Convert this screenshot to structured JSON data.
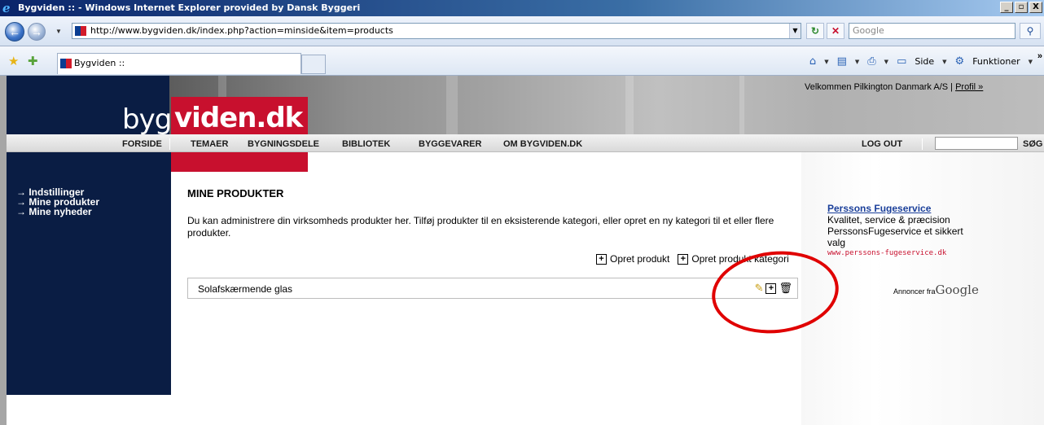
{
  "window": {
    "title": "Bygviden :: - Windows Internet Explorer provided by Dansk Byggeri",
    "buttons": [
      "_",
      "ø",
      "X"
    ]
  },
  "address_bar": {
    "url": "http://www.bygviden.dk/index.php?action=minside&item=products",
    "search_placeholder": "Google"
  },
  "tab_bar": {
    "tab_title": "Bygviden ::",
    "side_label": "Side",
    "functions_label": "Funktioner"
  },
  "site": {
    "logo_left": "byg",
    "logo_right": "viden.dk",
    "welcome_text": "Velkommen Pilkington Danmark A/S |",
    "profile_link": "Profil »",
    "menu": [
      "FORSIDE",
      "TEMAER",
      "BYGNINGSDELE",
      "BIBLIOTEK",
      "BYGGEVARER",
      "OM BYGVIDEN.DK"
    ],
    "logout": "LOG OUT",
    "search_label": "SØG"
  },
  "sidebar": {
    "items": [
      "→ Indstillinger",
      "→ Mine produkter",
      "→ Mine nyheder"
    ]
  },
  "main": {
    "title": "MINE PRODUKTER",
    "description": "Du kan administrere din virksomheds produkter her. Tilføj produkter til en eksisterende kategori, eller opret en ny kategori til et eller flere produkter.",
    "create_product": "Opret produkt",
    "create_category": "Opret produkt kategori",
    "categories": [
      {
        "name": "Solafskærmende glas"
      }
    ]
  },
  "ad": {
    "title": "Perssons Fugeservice",
    "text": "Kvalitet, service & præcision PerssonsFugeservice et sikkert valg",
    "url": "www.perssons-fugeservice.dk",
    "ads_by": "Annoncer fra",
    "google": "Google"
  }
}
